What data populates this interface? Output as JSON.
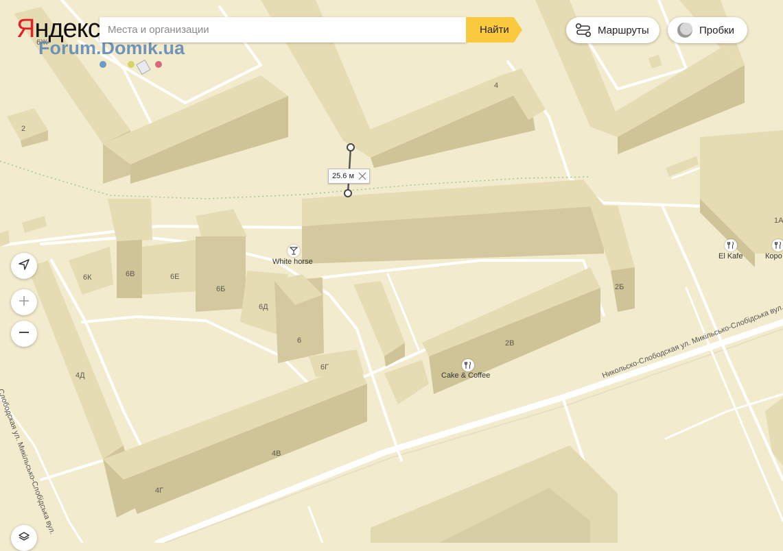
{
  "header": {
    "logo_first": "Я",
    "logo_rest": "ндекс",
    "watermark": "Forum.Domik.ua"
  },
  "search": {
    "placeholder": "Места и организации",
    "button": "Найти"
  },
  "top_buttons": {
    "routes": "Маршруты",
    "traffic": "Пробки"
  },
  "controls": {
    "geolocation_icon": "navigation-arrow-icon",
    "zoom_in_icon": "plus-icon",
    "zoom_out_icon": "minus-icon",
    "layers_icon": "layers-icon"
  },
  "measure": {
    "distance": "25.6 м"
  },
  "buildings": [
    {
      "id": "b-6zh",
      "label": "6Ж"
    },
    {
      "id": "b-2",
      "label": "2"
    },
    {
      "id": "b-4",
      "label": "4"
    },
    {
      "id": "b-6k",
      "label": "6К"
    },
    {
      "id": "b-6v",
      "label": "6В"
    },
    {
      "id": "b-6e",
      "label": "6Е"
    },
    {
      "id": "b-6b",
      "label": "6Б"
    },
    {
      "id": "b-6d",
      "label": "6Д"
    },
    {
      "id": "b-6",
      "label": "6"
    },
    {
      "id": "b-6g",
      "label": "6Г"
    },
    {
      "id": "b-2b",
      "label": "2Б"
    },
    {
      "id": "b-2v",
      "label": "2В"
    },
    {
      "id": "b-4d",
      "label": "4Д"
    },
    {
      "id": "b-4v",
      "label": "4В"
    },
    {
      "id": "b-4g",
      "label": "4Г"
    },
    {
      "id": "b-1a",
      "label": "1А"
    }
  ],
  "pois": [
    {
      "name": "White horse",
      "icon": "cocktail-icon"
    },
    {
      "name": "Cake & Coffee",
      "icon": "fork-knife-icon"
    },
    {
      "name": "El Kafe",
      "icon": "fork-knife-icon"
    },
    {
      "name": "Коро",
      "icon": "fork-knife-icon"
    }
  ],
  "streets": [
    {
      "id": "street-main",
      "name": "Никольско-Слободская ул.  Микільсько-Слобідська вул."
    },
    {
      "id": "street-left",
      "name": "Слободская ул.  Микільсько-Слобідська вул."
    }
  ],
  "colors": {
    "land": "#f3ebce",
    "building_top": "#e9dfb8",
    "building_side": "#d6cba1",
    "road": "#ffffff",
    "accent_button": "#fbc93d",
    "logo_red": "#e31e24"
  }
}
